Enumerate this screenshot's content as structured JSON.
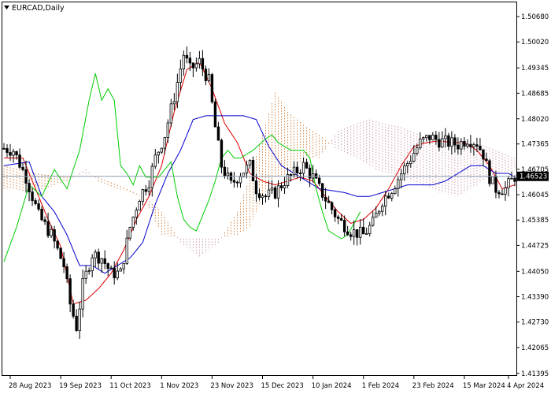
{
  "chart_data": {
    "type": "candlestick",
    "title": "EURCAD,Daily",
    "symbol": "EURCAD",
    "timeframe": "Daily",
    "current_price": "1.46523",
    "ylim": [
      1.4135,
      1.5105
    ],
    "yticks": [
      "1.50680",
      "1.50020",
      "1.49345",
      "1.48685",
      "1.48020",
      "1.47365",
      "1.46705",
      "1.46045",
      "1.45385",
      "1.44725",
      "1.44050",
      "1.43390",
      "1.42730",
      "1.42065",
      "1.41395"
    ],
    "xticks": [
      {
        "label": "28 Aug 2023",
        "bar": 2
      },
      {
        "label": "19 Sep 2023",
        "bar": 18
      },
      {
        "label": "11 Oct 2023",
        "bar": 34
      },
      {
        "label": "1 Nov 2023",
        "bar": 50
      },
      {
        "label": "23 Nov 2023",
        "bar": 66
      },
      {
        "label": "15 Dec 2023",
        "bar": 82
      },
      {
        "label": "10 Jan 2024",
        "bar": 98
      },
      {
        "label": "1 Feb 2024",
        "bar": 114
      },
      {
        "label": "23 Feb 2024",
        "bar": 130
      },
      {
        "label": "15 Mar 2024",
        "bar": 146
      },
      {
        "label": "4 Apr 2024",
        "bar": 160
      }
    ],
    "bars_total": 163,
    "price_waypoints": [
      [
        0,
        1.4725
      ],
      [
        3,
        1.472
      ],
      [
        7,
        1.465
      ],
      [
        11,
        1.455
      ],
      [
        15,
        1.45
      ],
      [
        19,
        1.442
      ],
      [
        21,
        1.432
      ],
      [
        23,
        1.426
      ],
      [
        25,
        1.437
      ],
      [
        28,
        1.445
      ],
      [
        31,
        1.444
      ],
      [
        34,
        1.44
      ],
      [
        37,
        1.44
      ],
      [
        40,
        1.452
      ],
      [
        43,
        1.46
      ],
      [
        46,
        1.464
      ],
      [
        48,
        1.47
      ],
      [
        51,
        1.476
      ],
      [
        54,
        1.486
      ],
      [
        57,
        1.497
      ],
      [
        59,
        1.493
      ],
      [
        62,
        1.495
      ],
      [
        65,
        1.49
      ],
      [
        67,
        1.478
      ],
      [
        69,
        1.468
      ],
      [
        72,
        1.463
      ],
      [
        75,
        1.466
      ],
      [
        78,
        1.468
      ],
      [
        80,
        1.462
      ],
      [
        83,
        1.46
      ],
      [
        86,
        1.461
      ],
      [
        89,
        1.464
      ],
      [
        92,
        1.466
      ],
      [
        95,
        1.468
      ],
      [
        98,
        1.465
      ],
      [
        100,
        1.462
      ],
      [
        103,
        1.458
      ],
      [
        106,
        1.454
      ],
      [
        110,
        1.451
      ],
      [
        114,
        1.45
      ],
      [
        117,
        1.453
      ],
      [
        120,
        1.459
      ],
      [
        123,
        1.462
      ],
      [
        126,
        1.466
      ],
      [
        129,
        1.47
      ],
      [
        132,
        1.474
      ],
      [
        135,
        1.4755
      ],
      [
        138,
        1.4745
      ],
      [
        141,
        1.474
      ],
      [
        144,
        1.4735
      ],
      [
        147,
        1.475
      ],
      [
        150,
        1.474
      ],
      [
        152,
        1.471
      ],
      [
        154,
        1.465
      ],
      [
        156,
        1.462
      ],
      [
        159,
        1.462
      ],
      [
        162,
        1.4652
      ]
    ],
    "lines": [
      {
        "name": "tenkan",
        "color": "#dd0000",
        "points": [
          [
            0,
            1.47
          ],
          [
            6,
            1.47
          ],
          [
            10,
            1.462
          ],
          [
            14,
            1.454
          ],
          [
            18,
            1.447
          ],
          [
            22,
            1.432
          ],
          [
            26,
            1.433
          ],
          [
            30,
            1.436
          ],
          [
            34,
            1.44
          ],
          [
            38,
            1.446
          ],
          [
            42,
            1.454
          ],
          [
            46,
            1.46
          ],
          [
            50,
            1.468
          ],
          [
            54,
            1.482
          ],
          [
            58,
            1.493
          ],
          [
            62,
            1.495
          ],
          [
            66,
            1.488
          ],
          [
            70,
            1.479
          ],
          [
            74,
            1.474
          ],
          [
            78,
            1.466
          ],
          [
            82,
            1.464
          ],
          [
            86,
            1.463
          ],
          [
            90,
            1.464
          ],
          [
            94,
            1.465
          ],
          [
            98,
            1.464
          ],
          [
            102,
            1.46
          ],
          [
            106,
            1.456
          ],
          [
            110,
            1.453
          ],
          [
            114,
            1.454
          ],
          [
            118,
            1.457
          ],
          [
            122,
            1.462
          ],
          [
            126,
            1.468
          ],
          [
            130,
            1.473
          ],
          [
            134,
            1.474
          ],
          [
            138,
            1.4745
          ],
          [
            142,
            1.474
          ],
          [
            146,
            1.474
          ],
          [
            150,
            1.472
          ],
          [
            154,
            1.468
          ],
          [
            158,
            1.462
          ],
          [
            162,
            1.463
          ]
        ]
      },
      {
        "name": "kijun",
        "color": "#0000cc",
        "points": [
          [
            0,
            1.468
          ],
          [
            8,
            1.469
          ],
          [
            12,
            1.46
          ],
          [
            16,
            1.456
          ],
          [
            20,
            1.45
          ],
          [
            24,
            1.442
          ],
          [
            28,
            1.442
          ],
          [
            32,
            1.44
          ],
          [
            36,
            1.442
          ],
          [
            40,
            1.444
          ],
          [
            44,
            1.448
          ],
          [
            48,
            1.458
          ],
          [
            52,
            1.466
          ],
          [
            56,
            1.472
          ],
          [
            60,
            1.48
          ],
          [
            64,
            1.481
          ],
          [
            68,
            1.481
          ],
          [
            72,
            1.481
          ],
          [
            76,
            1.481
          ],
          [
            80,
            1.48
          ],
          [
            84,
            1.473
          ],
          [
            88,
            1.468
          ],
          [
            92,
            1.466
          ],
          [
            96,
            1.464
          ],
          [
            100,
            1.462
          ],
          [
            104,
            1.4615
          ],
          [
            108,
            1.461
          ],
          [
            112,
            1.46
          ],
          [
            116,
            1.46
          ],
          [
            120,
            1.461
          ],
          [
            124,
            1.462
          ],
          [
            128,
            1.463
          ],
          [
            132,
            1.463
          ],
          [
            136,
            1.463
          ],
          [
            140,
            1.464
          ],
          [
            144,
            1.466
          ],
          [
            148,
            1.468
          ],
          [
            152,
            1.468
          ],
          [
            156,
            1.466
          ],
          [
            160,
            1.466
          ],
          [
            162,
            1.465
          ]
        ]
      },
      {
        "name": "chikou",
        "color": "#00cc00",
        "points": [
          [
            0,
            1.443
          ],
          [
            4,
            1.452
          ],
          [
            8,
            1.463
          ],
          [
            12,
            1.46
          ],
          [
            16,
            1.467
          ],
          [
            20,
            1.462
          ],
          [
            24,
            1.472
          ],
          [
            27,
            1.485
          ],
          [
            29,
            1.492
          ],
          [
            31,
            1.485
          ],
          [
            33,
            1.488
          ],
          [
            35,
            1.485
          ],
          [
            37,
            1.468
          ],
          [
            39,
            1.466
          ],
          [
            41,
            1.463
          ],
          [
            43,
            1.468
          ],
          [
            45,
            1.465
          ],
          [
            47,
            1.465
          ],
          [
            49,
            1.465
          ],
          [
            51,
            1.467
          ],
          [
            53,
            1.469
          ],
          [
            55,
            1.46
          ],
          [
            57,
            1.454
          ],
          [
            59,
            1.452
          ],
          [
            61,
            1.451
          ],
          [
            63,
            1.455
          ],
          [
            65,
            1.459
          ],
          [
            67,
            1.464
          ],
          [
            69,
            1.47
          ],
          [
            71,
            1.472
          ],
          [
            73,
            1.47
          ],
          [
            75,
            1.47
          ],
          [
            77,
            1.471
          ],
          [
            79,
            1.472
          ],
          [
            81,
            1.4735
          ],
          [
            83,
            1.475
          ],
          [
            85,
            1.476
          ],
          [
            87,
            1.474
          ],
          [
            89,
            1.473
          ],
          [
            91,
            1.472
          ],
          [
            93,
            1.472
          ],
          [
            95,
            1.472
          ],
          [
            97,
            1.47
          ],
          [
            99,
            1.462
          ],
          [
            101,
            1.456
          ],
          [
            103,
            1.451
          ],
          [
            105,
            1.45
          ],
          [
            107,
            1.449
          ],
          [
            109,
            1.45
          ],
          [
            111,
            1.453
          ],
          [
            113,
            1.456
          ]
        ]
      },
      {
        "name": "cloud_a",
        "color": "#d08040",
        "points": [
          [
            0,
            1.468
          ],
          [
            10,
            1.466
          ],
          [
            20,
            1.465
          ],
          [
            26,
            1.466
          ],
          [
            30,
            1.465
          ],
          [
            36,
            1.463
          ],
          [
            44,
            1.46
          ],
          [
            50,
            1.456
          ],
          [
            56,
            1.448
          ],
          [
            62,
            1.444
          ],
          [
            68,
            1.448
          ],
          [
            74,
            1.456
          ],
          [
            78,
            1.465
          ],
          [
            82,
            1.476
          ],
          [
            86,
            1.487
          ],
          [
            90,
            1.482
          ],
          [
            96,
            1.478
          ],
          [
            100,
            1.476
          ],
          [
            106,
            1.472
          ],
          [
            112,
            1.47
          ],
          [
            116,
            1.468
          ],
          [
            120,
            1.466
          ],
          [
            126,
            1.465
          ],
          [
            132,
            1.463
          ],
          [
            138,
            1.461
          ],
          [
            144,
            1.46
          ],
          [
            150,
            1.463
          ],
          [
            156,
            1.466
          ],
          [
            162,
            1.467
          ]
        ]
      },
      {
        "name": "cloud_b",
        "color": "#cc99aa",
        "points": [
          [
            0,
            1.462
          ],
          [
            10,
            1.461
          ],
          [
            20,
            1.464
          ],
          [
            26,
            1.467
          ],
          [
            30,
            1.464
          ],
          [
            36,
            1.462
          ],
          [
            44,
            1.46
          ],
          [
            50,
            1.45
          ],
          [
            56,
            1.449
          ],
          [
            62,
            1.449
          ],
          [
            68,
            1.449
          ],
          [
            74,
            1.45
          ],
          [
            78,
            1.452
          ],
          [
            82,
            1.46
          ],
          [
            86,
            1.465
          ],
          [
            90,
            1.466
          ],
          [
            96,
            1.47
          ],
          [
            100,
            1.47
          ],
          [
            106,
            1.477
          ],
          [
            112,
            1.479
          ],
          [
            116,
            1.48
          ],
          [
            120,
            1.479
          ],
          [
            126,
            1.478
          ],
          [
            132,
            1.476
          ],
          [
            138,
            1.474
          ],
          [
            144,
            1.473
          ],
          [
            150,
            1.474
          ],
          [
            156,
            1.472
          ],
          [
            162,
            1.47
          ]
        ]
      }
    ]
  }
}
